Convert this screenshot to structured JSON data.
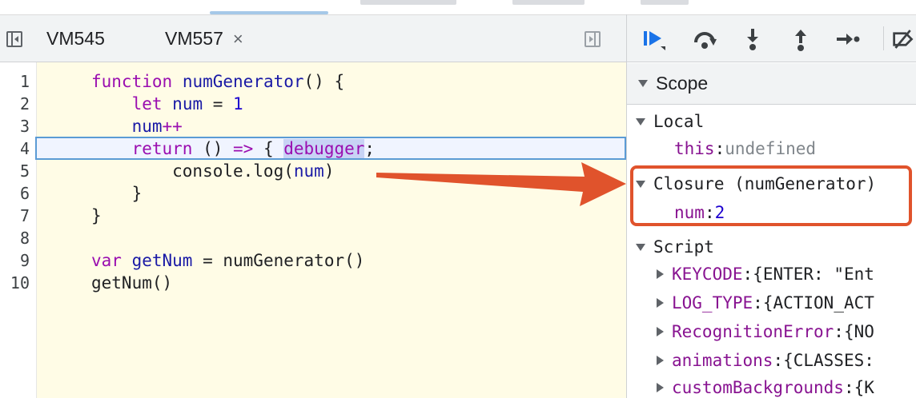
{
  "tabs": [
    {
      "label": "VM545"
    },
    {
      "label": "VM557",
      "close": "×"
    }
  ],
  "editor": {
    "line_numbers": [
      "1",
      "2",
      "3",
      "4",
      "5",
      "6",
      "7",
      "8",
      "9",
      "10"
    ]
  },
  "scope": {
    "header": "Scope",
    "local": {
      "label": "Local",
      "this_key": "this",
      "this_value": "undefined"
    },
    "closure": {
      "label": "Closure (numGenerator)",
      "num_key": "num",
      "num_value": "2"
    },
    "script": {
      "label": "Script",
      "items": [
        {
          "key": "KEYCODE",
          "value": "{ENTER: \"Ent"
        },
        {
          "key": "LOG_TYPE",
          "value": "{ACTION_ACT"
        },
        {
          "key": "RecognitionError",
          "value": "{NO"
        },
        {
          "key": "animations",
          "value": "{CLASSES:"
        },
        {
          "key": "customBackgrounds",
          "value": "{K"
        }
      ]
    }
  },
  "colors": {
    "annotation_arrow": "#e0532c",
    "highlight_border": "#5b9bd5",
    "editor_bg": "#fffce6"
  },
  "icons": [
    "resume-icon",
    "step-over-icon",
    "step-into-icon",
    "step-out-icon",
    "step-icon",
    "deactivate-breakpoints-icon"
  ]
}
